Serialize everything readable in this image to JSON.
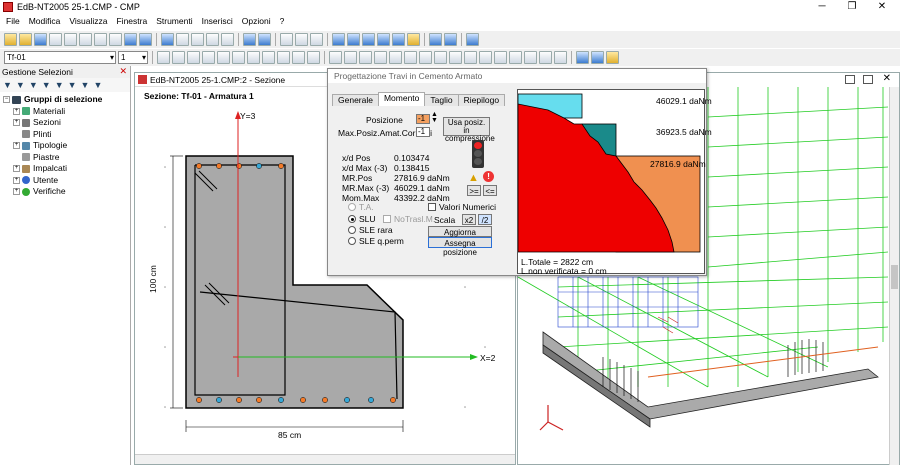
{
  "app": {
    "title": "EdB-NT2005 25-1.CMP - CMP",
    "minimize": "─",
    "maximize": "❐",
    "close": "✕"
  },
  "menu": [
    "File",
    "Modifica",
    "Visualizza",
    "Finestra",
    "Strumenti",
    "Inserisci",
    "Opzioni",
    "?"
  ],
  "toolbar": {
    "combo_section": "Tf-01",
    "combo_number": "1"
  },
  "selection_panel": {
    "title": "Gestione Selezioni",
    "root": "Gruppi di selezione",
    "items": [
      "Materiali",
      "Sezioni",
      "Plinti",
      "Tipologie",
      "Piastre",
      "Impalcati",
      "Utente",
      "Verifiche"
    ]
  },
  "section_window": {
    "title": "EdB-NT2005 25-1.CMP:2 - Sezione",
    "subtitle": "Sezione: Tf-01 - Armatura 1",
    "axis_y": "Y=3",
    "axis_x": "X=2",
    "dim_height": "100 cm",
    "dim_width": "85 cm"
  },
  "dialog": {
    "title": "Progettazione Travi in Cemento Armato",
    "tabs": [
      "Generale",
      "Momento",
      "Taglio",
      "Riepilogo"
    ],
    "active_tab": "Momento",
    "posizione_label": "Posizione",
    "posizione_value": "-1",
    "max_pos_label": "Max.Posiz.Amat.Correnti",
    "max_pos_value": "-1",
    "btn_usa": "Usa posiz. in compressione",
    "results": [
      {
        "label": "x/d Pos",
        "value": "0.103474"
      },
      {
        "label": "x/d Max (-3)",
        "value": "0.138415"
      },
      {
        "label": "MR.Pos",
        "value": "27816.9 daNm"
      },
      {
        "label": "MR.Max (-3)",
        "value": "46029.1 daNm"
      },
      {
        "label": "Mom.Max",
        "value": "43392.2 daNm"
      }
    ],
    "btn_ge": ">=",
    "btn_le": "<=",
    "radio_ta": "T.A.",
    "radio_slu": "SLU",
    "radio_sle_rara": "SLE rara",
    "radio_sle_qperm": "SLE q.perm",
    "chk_notrasl": "NoTrasl.M.",
    "chk_valori": "Valori Numerici",
    "scala_label": "Scala",
    "btn_x2": "x2",
    "btn_half": "/2",
    "btn_aggiorna": "Aggiorna",
    "btn_assegna": "Assegna posizione",
    "chart": {
      "levels": [
        "46029.1 daNm",
        "36923.5 daNm",
        "27816.9 daNm"
      ],
      "l_totale": "L.Totale = 2822 cm",
      "l_non_verificata": "L.non verificata = 0 cm"
    }
  },
  "colors": {
    "concrete": "#a9a9a9",
    "moment_fill": "#ee0000",
    "level_cyan": "#66ddee",
    "level_teal": "#1a8a8a",
    "level_orange": "#f09050",
    "mesh_green": "#22cc22"
  }
}
